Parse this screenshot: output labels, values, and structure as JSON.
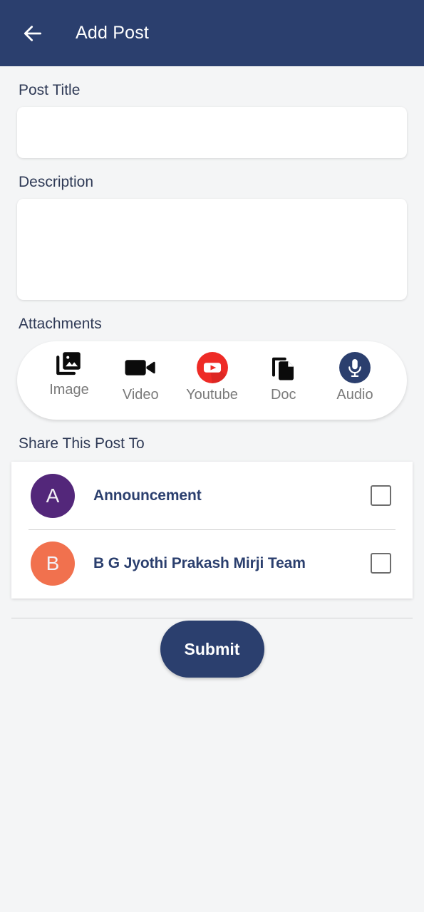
{
  "appbar": {
    "back_icon": "arrow-left-icon",
    "title": "Add Post"
  },
  "form": {
    "title_label": "Post Title",
    "title_value": "",
    "title_placeholder": "",
    "description_label": "Description",
    "description_value": "",
    "description_placeholder": ""
  },
  "attachments": {
    "label": "Attachments",
    "items": [
      {
        "label": "Image",
        "icon": "photo-library-icon"
      },
      {
        "label": "Video",
        "icon": "videocam-icon"
      },
      {
        "label": "Youtube",
        "icon": "youtube-icon"
      },
      {
        "label": "Doc",
        "icon": "document-copy-icon"
      },
      {
        "label": "Audio",
        "icon": "microphone-icon"
      }
    ]
  },
  "share": {
    "label": "Share This Post To",
    "rows": [
      {
        "initial": "A",
        "name": "Announcement",
        "avatar_color": "#53277A",
        "checked": false
      },
      {
        "initial": "B",
        "name": "B G Jyothi Prakash Mirji Team",
        "avatar_color": "#F1714E",
        "checked": false
      }
    ]
  },
  "submit": {
    "label": "Submit"
  },
  "colors": {
    "primary": "#2B3F6E",
    "background": "#F4F5F6",
    "surface": "#FFFFFF",
    "muted_text": "#7A7A7A",
    "youtube_red": "#EE2B26"
  }
}
